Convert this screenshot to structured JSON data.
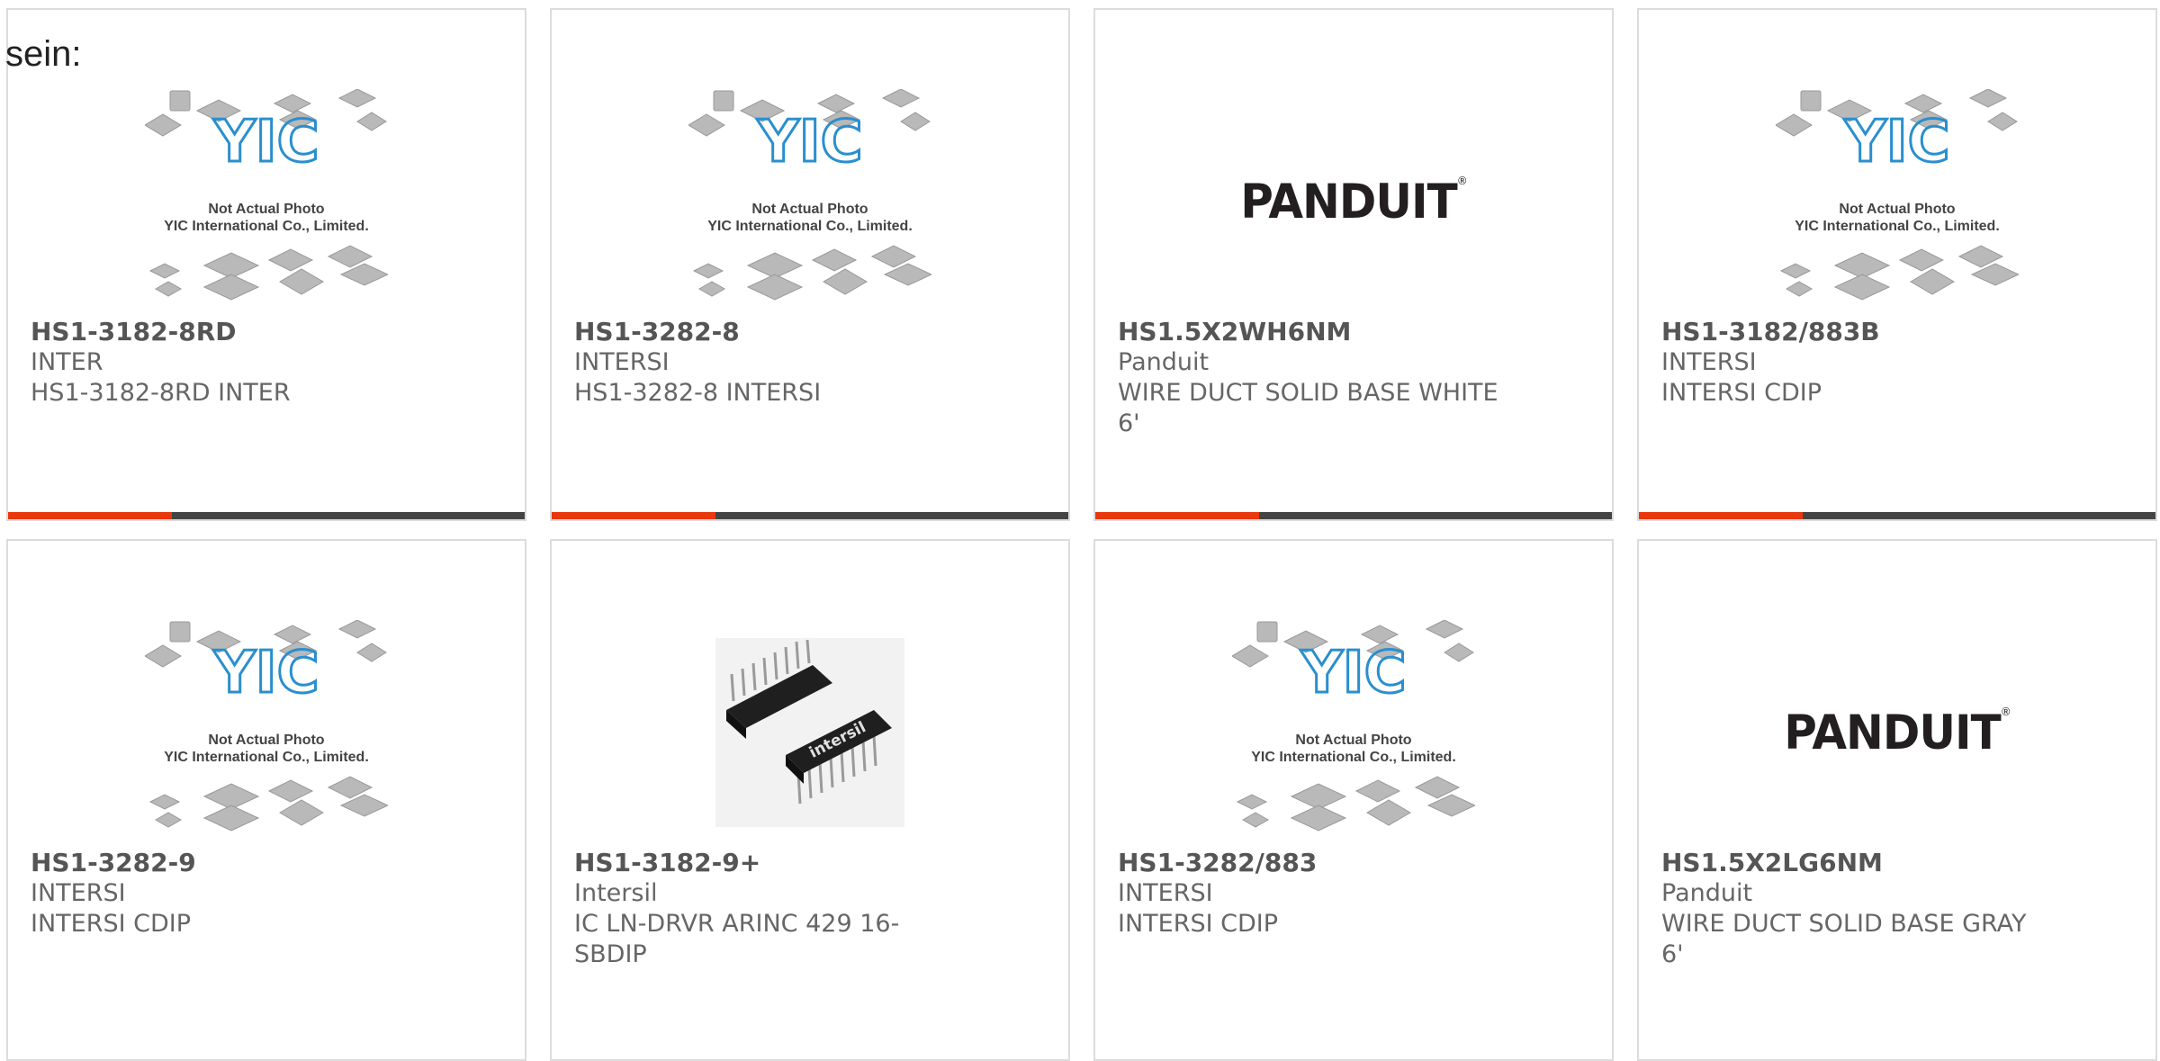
{
  "page": {
    "label": "sein:"
  },
  "placeholder": {
    "caption_line1": "Not Actual Photo",
    "caption_line2": "YIC International Co., Limited.",
    "logo_text": "YIC"
  },
  "brand_logo": {
    "text": "PANDUIT",
    "mark": "®"
  },
  "colors": {
    "accent": "#e8380d",
    "bar": "#444444",
    "yic_blue": "#2a8fce"
  },
  "products": [
    {
      "part_no": "HS1-3182-8RD",
      "manufacturer": "INTER",
      "description": "HS1-3182-8RD INTER",
      "image": "yic-placeholder"
    },
    {
      "part_no": "HS1-3282-8",
      "manufacturer": "INTERSI",
      "description": "HS1-3282-8 INTERSI",
      "image": "yic-placeholder"
    },
    {
      "part_no": "HS1.5X2WH6NM",
      "manufacturer": "Panduit",
      "description": "WIRE DUCT SOLID BASE WHITE 6'",
      "image": "panduit-logo"
    },
    {
      "part_no": "HS1-3182/883B",
      "manufacturer": "INTERSI",
      "description": "INTERSI CDIP",
      "image": "yic-placeholder"
    },
    {
      "part_no": "HS1-3282-9",
      "manufacturer": "INTERSI",
      "description": "INTERSI CDIP",
      "image": "yic-placeholder"
    },
    {
      "part_no": "HS1-3182-9+",
      "manufacturer": "Intersil",
      "description": "IC LN-DRVR ARINC 429 16-SBDIP",
      "image": "dip-chip-photo",
      "chip_marking": "intersil"
    },
    {
      "part_no": "HS1-3282/883",
      "manufacturer": "INTERSI",
      "description": "INTERSI CDIP",
      "image": "yic-placeholder"
    },
    {
      "part_no": "HS1.5X2LG6NM",
      "manufacturer": "Panduit",
      "description": "WIRE DUCT SOLID BASE GRAY 6'",
      "image": "panduit-logo"
    }
  ]
}
